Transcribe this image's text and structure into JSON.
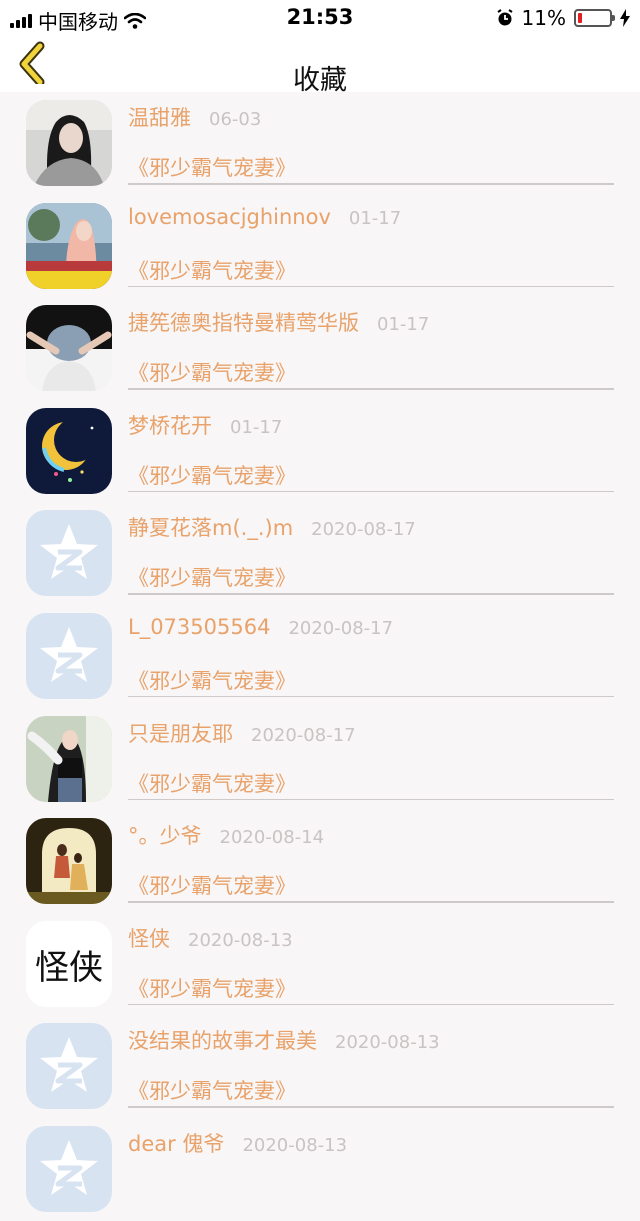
{
  "status_bar": {
    "carrier": "中国移动",
    "time": "21:53",
    "battery": "11%",
    "battery_level": 0.11
  },
  "header": {
    "title": "收藏",
    "back_icon": "chevron-left-icon"
  },
  "colors": {
    "accent": "#e8a26a",
    "date": "#c9c3c3",
    "background": "#f8f6f7"
  },
  "favorites": [
    {
      "name": "温甜雅",
      "date": "06-03",
      "book": "《邪少霸气宠妻》",
      "avatar": "photo-girl-dark-hair"
    },
    {
      "name": "lovemosacjghinnov",
      "date": "01-17",
      "book": "《邪少霸气宠妻》",
      "avatar": "photo-girl-caption"
    },
    {
      "name": "捷筅德奥指特曼精莺华版",
      "date": "01-17",
      "book": "《邪少霸气宠妻》",
      "avatar": "photo-hands-head"
    },
    {
      "name": "梦桥花开",
      "date": "01-17",
      "book": "《邪少霸气宠妻》",
      "avatar": "crescent-moon-icon"
    },
    {
      "name": "静夏花落m(._.)m",
      "date": "2020-08-17",
      "book": "《邪少霸气宠妻》",
      "avatar": "qzone-star-icon"
    },
    {
      "name": "L_073505564",
      "date": "2020-08-17",
      "book": "《邪少霸气宠妻》",
      "avatar": "qzone-star-icon"
    },
    {
      "name": "只是朋友耶",
      "date": "2020-08-17",
      "book": "《邪少霸气宠妻》",
      "avatar": "photo-girl-black-top"
    },
    {
      "name": "°。少爷",
      "date": "2020-08-14",
      "book": "《邪少霸气宠妻》",
      "avatar": "photo-couple-doorway"
    },
    {
      "name": "怪侠",
      "date": "2020-08-13",
      "book": "《邪少霸气宠妻》",
      "avatar": "calligraphy-guaixia"
    },
    {
      "name": "没结果的故事才最美",
      "date": "2020-08-13",
      "book": "《邪少霸气宠妻》",
      "avatar": "qzone-star-icon"
    },
    {
      "name": "dear 傀爷",
      "date": "2020-08-13",
      "book": "",
      "avatar": "qzone-star-icon"
    }
  ],
  "avatar_calligraphy_text": "怪侠"
}
